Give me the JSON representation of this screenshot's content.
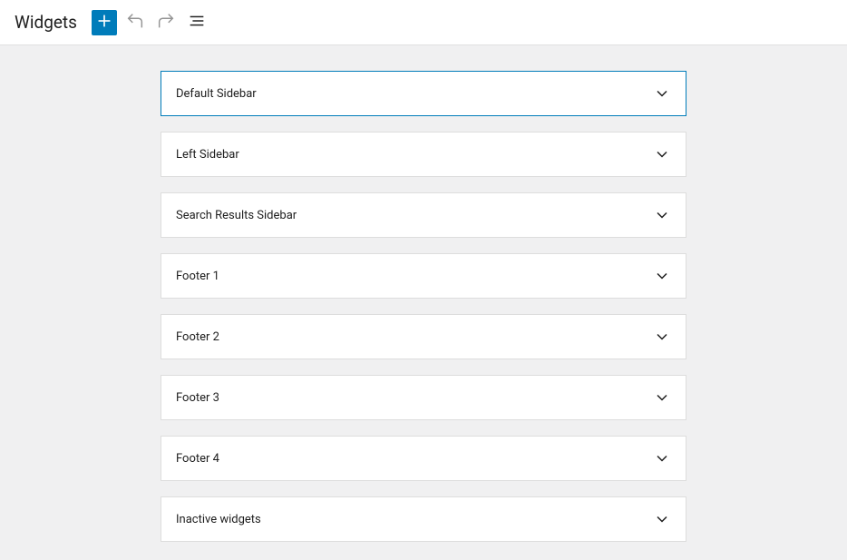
{
  "header": {
    "title": "Widgets"
  },
  "widgetAreas": [
    {
      "label": "Default Sidebar",
      "selected": true
    },
    {
      "label": "Left Sidebar",
      "selected": false
    },
    {
      "label": "Search Results Sidebar",
      "selected": false
    },
    {
      "label": "Footer 1",
      "selected": false
    },
    {
      "label": "Footer 2",
      "selected": false
    },
    {
      "label": "Footer 3",
      "selected": false
    },
    {
      "label": "Footer 4",
      "selected": false
    },
    {
      "label": "Inactive widgets",
      "selected": false
    }
  ]
}
